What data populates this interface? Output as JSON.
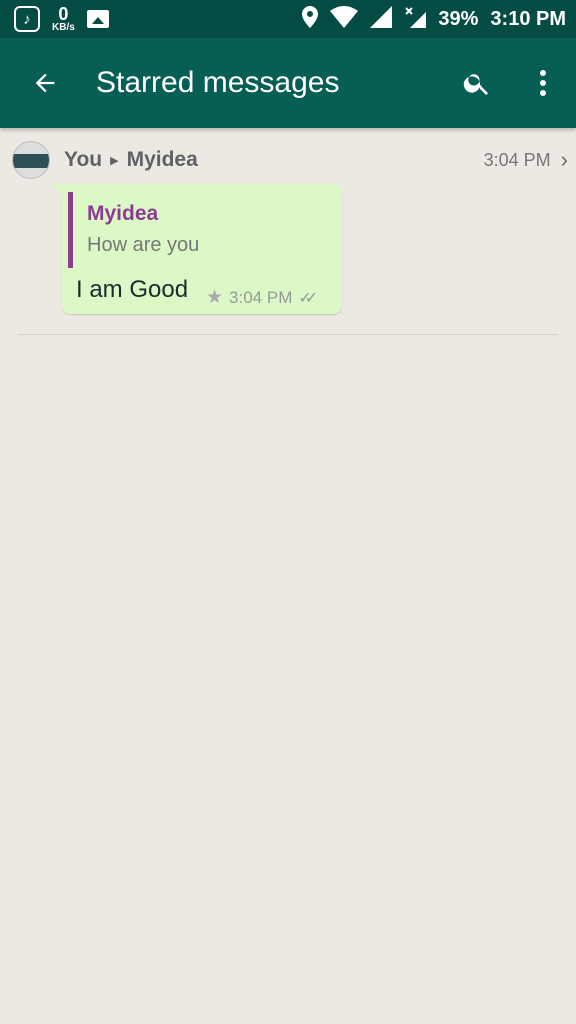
{
  "status_bar": {
    "network_speed": "0",
    "network_unit": "KB/s",
    "battery_percent": "39%",
    "time": "3:10 PM"
  },
  "app_bar": {
    "title": "Starred messages"
  },
  "message": {
    "sender": "You",
    "recipient": "Myidea",
    "header_time": "3:04 PM",
    "quote_author": "Myidea",
    "quote_text": "How are you",
    "text": "I am Good",
    "time": "3:04 PM"
  },
  "colors": {
    "app_bar": "#075e54",
    "status_bar": "#054d44",
    "bubble": "#dcf8c6",
    "quote_accent": "#8d3c94",
    "background": "#ece9e2"
  }
}
